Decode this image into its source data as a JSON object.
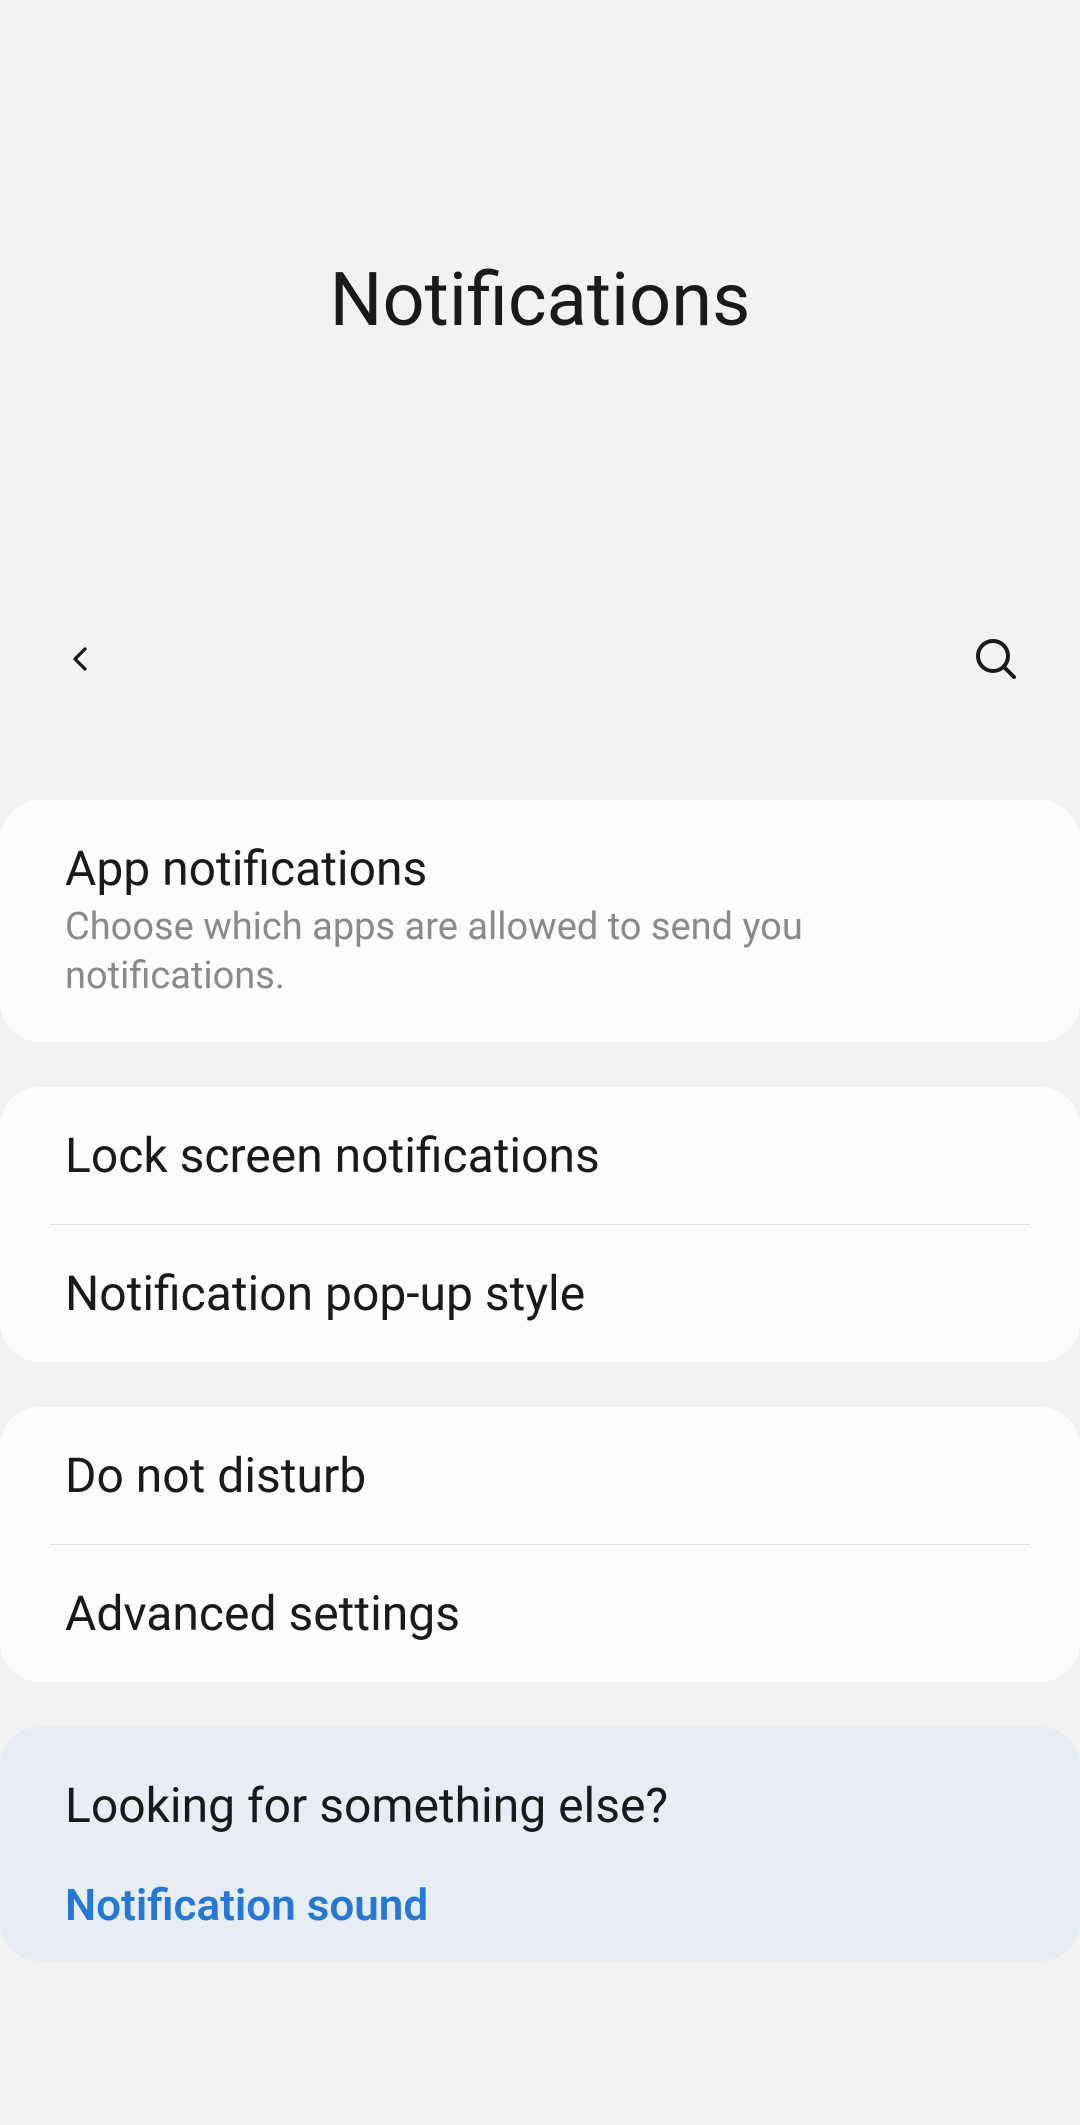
{
  "header": {
    "title": "Notifications"
  },
  "cards": [
    {
      "items": [
        {
          "title": "App notifications",
          "subtitle": "Choose which apps are allowed to send you notifications."
        }
      ]
    },
    {
      "items": [
        {
          "title": "Lock screen notifications"
        },
        {
          "title": "Notification pop-up style"
        }
      ]
    },
    {
      "items": [
        {
          "title": "Do not disturb"
        },
        {
          "title": "Advanced settings"
        }
      ]
    }
  ],
  "info": {
    "title": "Looking for something else?",
    "link": "Notification sound"
  }
}
